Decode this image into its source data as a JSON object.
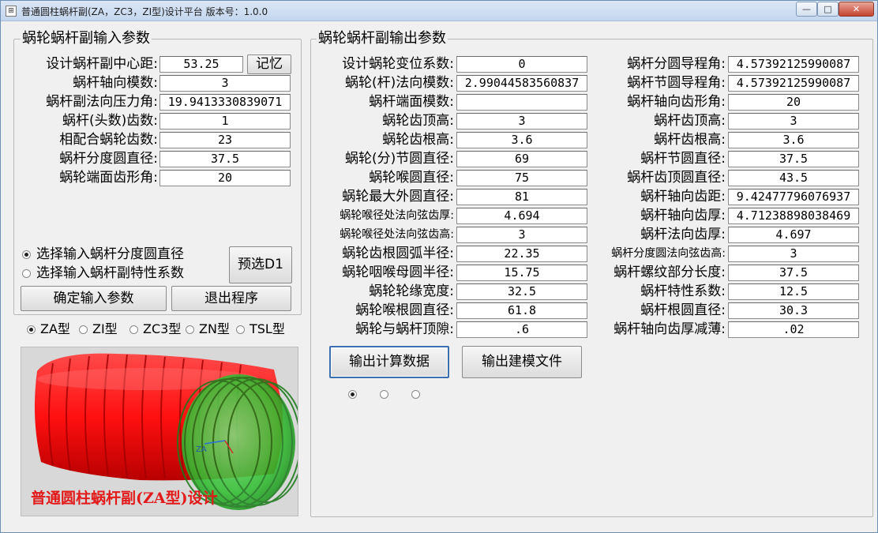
{
  "window": {
    "title": "普通圆柱蜗杆副(ZA，ZC3，ZI型)设计平台  版本号：1.0.0",
    "controls": {
      "minimize": "—",
      "maximize": "□",
      "close": "✕"
    }
  },
  "input_group": {
    "title": "蜗轮蜗杆副输入参数",
    "fields": [
      {
        "label": "设计蜗杆副中心距:",
        "value": "53.25"
      },
      {
        "label": "蜗杆轴向模数:",
        "value": "3"
      },
      {
        "label": "蜗杆副法向压力角:",
        "value": "19.9413330839071"
      },
      {
        "label": "蜗杆(头数)齿数:",
        "value": "1"
      },
      {
        "label": "相配合蜗轮齿数:",
        "value": "23"
      },
      {
        "label": "蜗杆分度圆直径:",
        "value": "37.5"
      },
      {
        "label": "蜗轮端面齿形角:",
        "value": "20"
      }
    ],
    "memory_button": "记忆",
    "radio_options": [
      "选择输入蜗杆分度圆直径",
      "选择输入蜗杆副特性系数"
    ],
    "radio_selected": 0,
    "preselect_button": "预选D1",
    "confirm_button": "确定输入参数",
    "exit_button": "退出程序"
  },
  "type_options": {
    "items": [
      "ZA型",
      "ZI型",
      "ZC3型",
      "ZN型",
      "TSL型"
    ],
    "selected": 0
  },
  "preview": {
    "caption": "普通圆柱蜗杆副(ZA型)设计",
    "axis_label": "ZA",
    "wheel_color": "#ff1a1a",
    "worm_color": "#33cc33"
  },
  "output_group": {
    "title": "蜗轮蜗杆副输出参数",
    "left": [
      {
        "label": "设计蜗轮变位系数:",
        "value": "0"
      },
      {
        "label": "蜗轮(杆)法向模数:",
        "value": "2.99044583560837"
      },
      {
        "label": "蜗杆端面模数:",
        "value": ""
      },
      {
        "label": "蜗轮齿顶高:",
        "value": "3"
      },
      {
        "label": "蜗轮齿根高:",
        "value": "3.6"
      },
      {
        "label": "蜗轮(分)节圆直径:",
        "value": "69"
      },
      {
        "label": "蜗轮喉圆直径:",
        "value": "75"
      },
      {
        "label": "蜗轮最大外圆直径:",
        "value": "81"
      },
      {
        "label": "蜗轮喉径处法向弦齿厚:",
        "value": "4.694",
        "small": true
      },
      {
        "label": "蜗轮喉径处法向弦齿高:",
        "value": "3",
        "small": true
      },
      {
        "label": "蜗轮齿根圆弧半径:",
        "value": "22.35"
      },
      {
        "label": "蜗轮咽喉母圆半径:",
        "value": "15.75"
      },
      {
        "label": "蜗轮轮缘宽度:",
        "value": "32.5"
      },
      {
        "label": "蜗轮喉根圆直径:",
        "value": "61.8"
      },
      {
        "label": "蜗轮与蜗杆顶隙:",
        "value": ".6"
      }
    ],
    "right": [
      {
        "label": "蜗杆分圆导程角:",
        "value": "4.57392125990087"
      },
      {
        "label": "蜗杆节圆导程角:",
        "value": "4.57392125990087"
      },
      {
        "label": "蜗杆轴向齿形角:",
        "value": "20"
      },
      {
        "label": "蜗杆齿顶高:",
        "value": "3"
      },
      {
        "label": "蜗杆齿根高:",
        "value": "3.6"
      },
      {
        "label": "蜗杆节圆直径:",
        "value": "37.5"
      },
      {
        "label": "蜗杆齿顶圆直径:",
        "value": "43.5"
      },
      {
        "label": "蜗杆轴向齿距:",
        "value": "9.42477796076937"
      },
      {
        "label": "蜗杆轴向齿厚:",
        "value": "4.71238898038469"
      },
      {
        "label": "蜗杆法向齿厚:",
        "value": "4.697"
      },
      {
        "label": "蜗杆分度圆法向弦齿高:",
        "value": "3",
        "small": true
      },
      {
        "label": "蜗杆螺纹部分长度:",
        "value": "37.5"
      },
      {
        "label": "蜗杆特性系数:",
        "value": "12.5"
      },
      {
        "label": "蜗杆根圆直径:",
        "value": "30.3"
      },
      {
        "label": "蜗杆轴向齿厚减薄:",
        "value": ".02"
      }
    ],
    "output_calc_button": "输出计算数据",
    "output_model_button": "输出建模文件",
    "small_radios_selected": 0
  }
}
